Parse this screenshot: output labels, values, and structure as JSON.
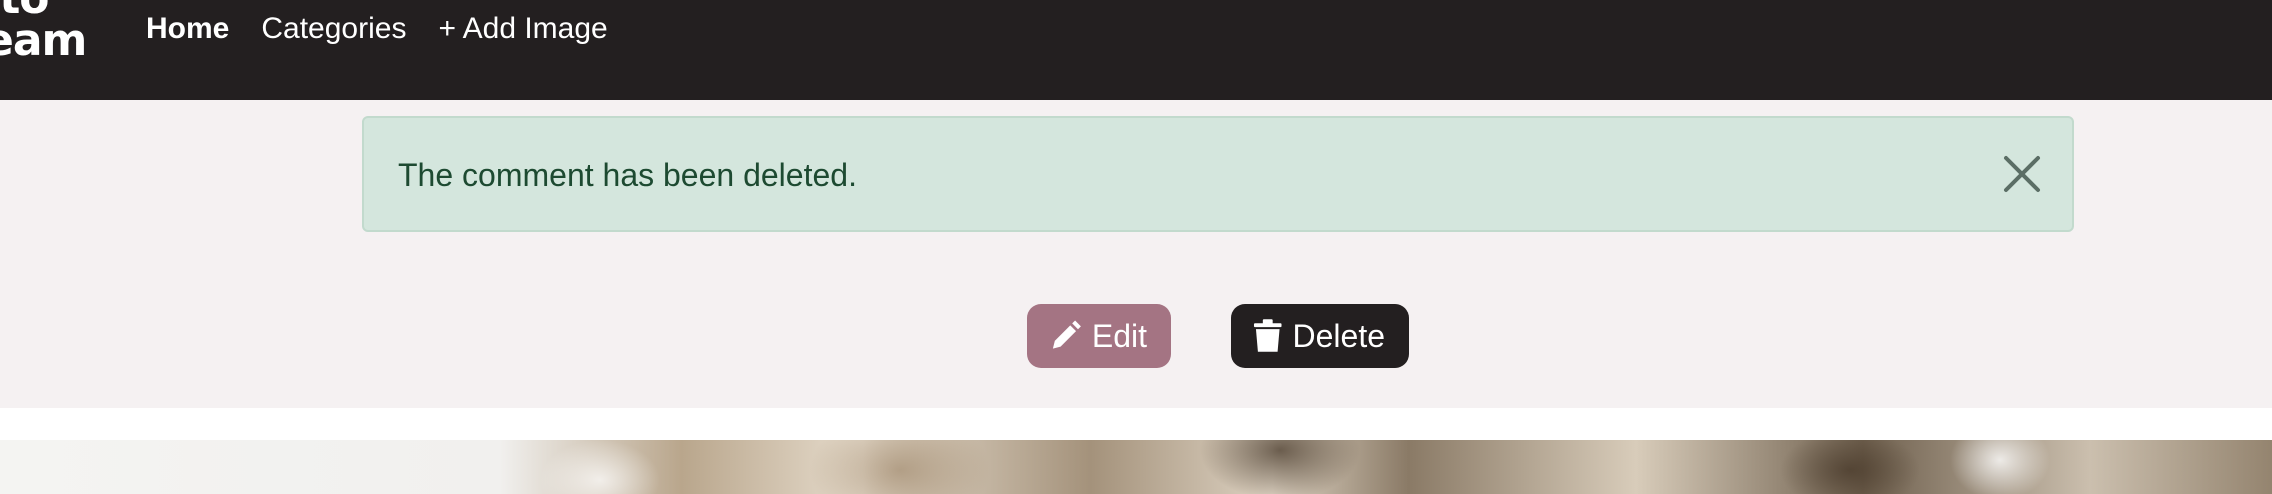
{
  "navbar": {
    "logo_line1": "oto",
    "logo_line2": "eam",
    "links": [
      {
        "label": "Home",
        "active": true
      },
      {
        "label": "Categories",
        "active": false
      },
      {
        "label": "+ Add Image",
        "active": false
      }
    ]
  },
  "alert": {
    "message": "The comment has been deleted.",
    "close_icon": "close-icon"
  },
  "actions": {
    "edit_label": "Edit",
    "edit_icon": "pencil-icon",
    "delete_label": "Delete",
    "delete_icon": "trash-icon"
  },
  "colors": {
    "navbar_bg": "#231f20",
    "alert_bg": "#d4e6dd",
    "alert_text": "#1d4a31",
    "edit_button": "#a47483",
    "delete_button": "#231f20"
  }
}
